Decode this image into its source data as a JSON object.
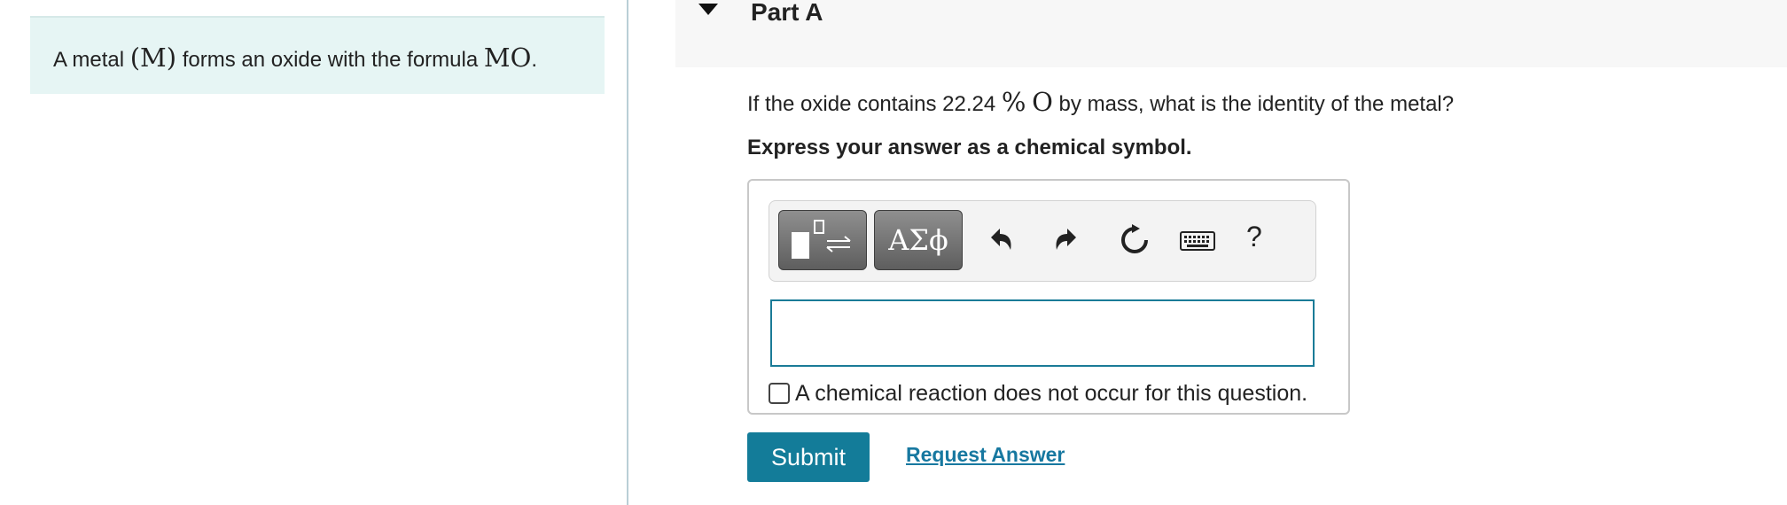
{
  "intro": {
    "text_before": "A metal ",
    "symbol_metal": "(M)",
    "text_middle": " forms an oxide with the formula ",
    "formula": "MO",
    "text_end": "."
  },
  "part": {
    "title": "Part A"
  },
  "question": {
    "text_before": "If the oxide contains 22.24 ",
    "percent_symbol": "%",
    "element_symbol": "O",
    "text_after": " by mass, what is the identity of the metal?"
  },
  "instruction": "Express your answer as a chemical symbol.",
  "toolbar": {
    "symbols_label": "ΑΣϕ",
    "help_label": "?",
    "icons": [
      "template-icon",
      "undo-icon",
      "redo-icon",
      "reset-icon",
      "keyboard-icon"
    ]
  },
  "answer": {
    "value": ""
  },
  "no_reaction": {
    "label": "A chemical reaction does not occur for this question.",
    "checked": false
  },
  "actions": {
    "submit_label": "Submit",
    "request_answer_label": "Request Answer"
  },
  "colors": {
    "accent": "#137c99",
    "intro_bg": "#e6f5f4",
    "link": "#1778a0"
  }
}
